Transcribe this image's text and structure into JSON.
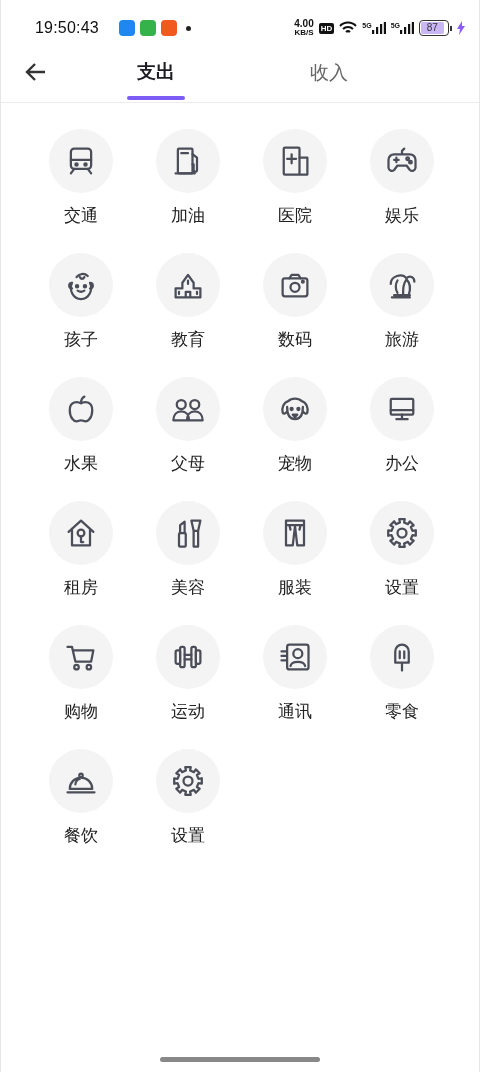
{
  "status_bar": {
    "time": "19:50:43",
    "app_icons": [
      {
        "color": "#1e88f0"
      },
      {
        "color": "#35b34a"
      },
      {
        "color": "#f05a1e"
      }
    ],
    "net_speed": "4.00",
    "net_unit": "KB/S",
    "hd": "HD",
    "signals": [
      "5G",
      "5G"
    ],
    "battery": "87",
    "charging": true
  },
  "header": {
    "tabs": [
      {
        "label": "支出",
        "selected": true
      },
      {
        "label": "收入",
        "selected": false
      }
    ]
  },
  "categories": [
    {
      "label": "交通",
      "kind": "train"
    },
    {
      "label": "加油",
      "kind": "fuel"
    },
    {
      "label": "医院",
      "kind": "hospital"
    },
    {
      "label": "娱乐",
      "kind": "gamepad"
    },
    {
      "label": "孩子",
      "kind": "baby"
    },
    {
      "label": "教育",
      "kind": "school"
    },
    {
      "label": "数码",
      "kind": "camera"
    },
    {
      "label": "旅游",
      "kind": "palm"
    },
    {
      "label": "水果",
      "kind": "apple"
    },
    {
      "label": "父母",
      "kind": "people"
    },
    {
      "label": "宠物",
      "kind": "dog"
    },
    {
      "label": "办公",
      "kind": "desktop"
    },
    {
      "label": "租房",
      "kind": "housekey"
    },
    {
      "label": "美容",
      "kind": "makeup"
    },
    {
      "label": "服装",
      "kind": "pants"
    },
    {
      "label": "设置",
      "kind": "gear"
    },
    {
      "label": "购物",
      "kind": "cart"
    },
    {
      "label": "运动",
      "kind": "dumbbell"
    },
    {
      "label": "通讯",
      "kind": "contact"
    },
    {
      "label": "零食",
      "kind": "popsicle"
    },
    {
      "label": "餐饮",
      "kind": "cloche"
    },
    {
      "label": "设置",
      "kind": "gear"
    }
  ]
}
